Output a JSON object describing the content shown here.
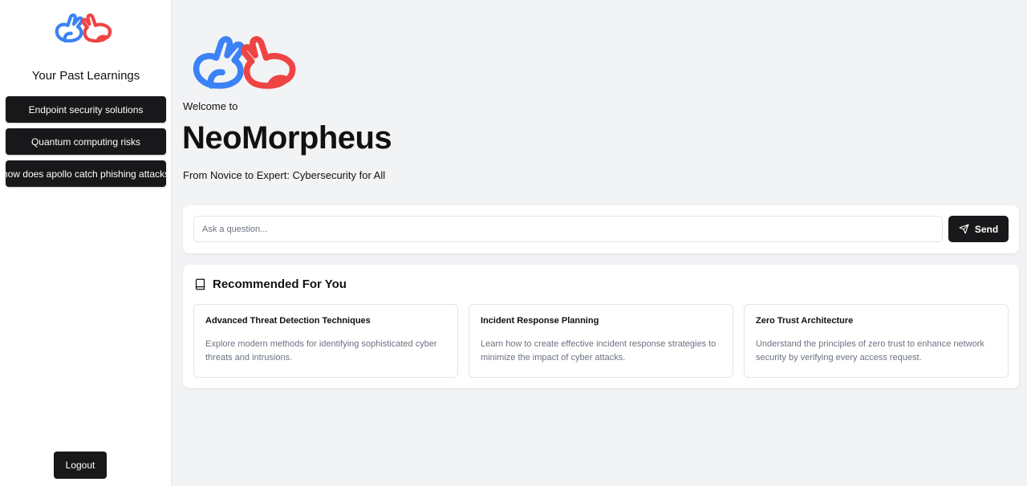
{
  "sidebar": {
    "title": "Your Past Learnings",
    "history": [
      "Endpoint security solutions",
      "Quantum computing risks",
      "how does apollo catch phishing attacks"
    ],
    "logout_label": "Logout"
  },
  "header": {
    "welcome": "Welcome to",
    "app_name": "NeoMorpheus",
    "tagline": "From Novice to Expert: Cybersecurity for All"
  },
  "ask": {
    "placeholder": "Ask a question...",
    "send_label": "Send"
  },
  "recommended": {
    "title": "Recommended For You",
    "items": [
      {
        "title": "Advanced Threat Detection Techniques",
        "description": "Explore modern methods for identifying sophisticated cyber threats and intrusions."
      },
      {
        "title": "Incident Response Planning",
        "description": "Learn how to create effective incident response strategies to minimize the impact of cyber attacks."
      },
      {
        "title": "Zero Trust Architecture",
        "description": "Understand the principles of zero trust to enhance network security by verifying every access request."
      }
    ]
  },
  "colors": {
    "logo_blue": "#3b82f6",
    "logo_red": "#ef4444",
    "button_dark": "#18181b",
    "background": "#f2f3f5"
  },
  "icons": {
    "logo": "rabbits-logo-icon",
    "send": "send-icon",
    "book": "book-icon"
  }
}
